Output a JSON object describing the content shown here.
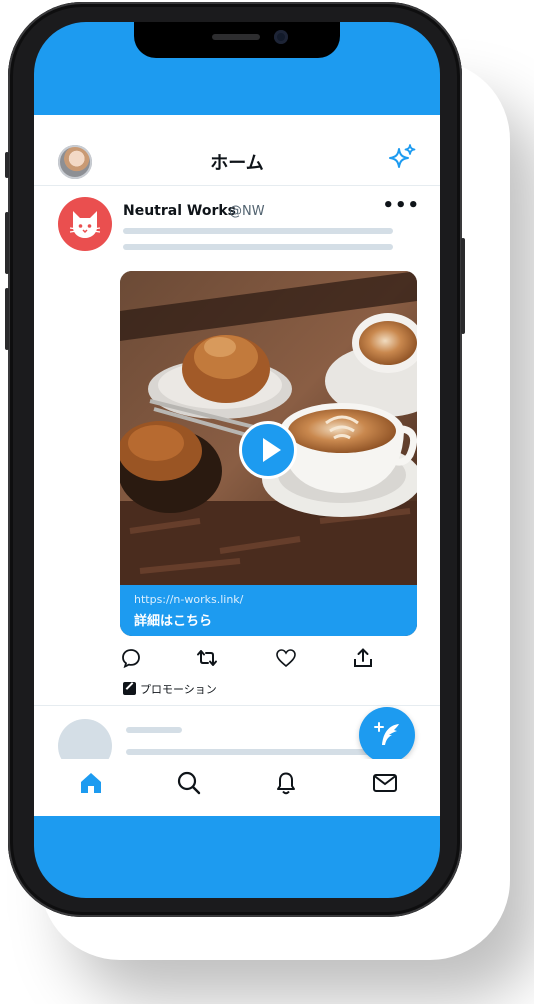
{
  "header": {
    "title": "ホーム"
  },
  "post": {
    "author_name": "Neutral Works",
    "author_handle": "@NW",
    "more_label": "•••",
    "link_url": "https://n-works.link/",
    "link_title": "詳細はこちら",
    "promotion_label": "プロモーション"
  },
  "icons": {
    "sparkle": "sparkle-icon",
    "reply": "reply-icon",
    "retweet": "retweet-icon",
    "like": "heart-icon",
    "share": "share-icon",
    "home": "home-icon",
    "search": "search-icon",
    "notifications": "bell-icon",
    "messages": "mail-icon",
    "compose": "compose-icon"
  },
  "colors": {
    "accent": "#1d9bf0",
    "avatar": "#ea4f4f",
    "placeholder": "#d4dee6"
  }
}
